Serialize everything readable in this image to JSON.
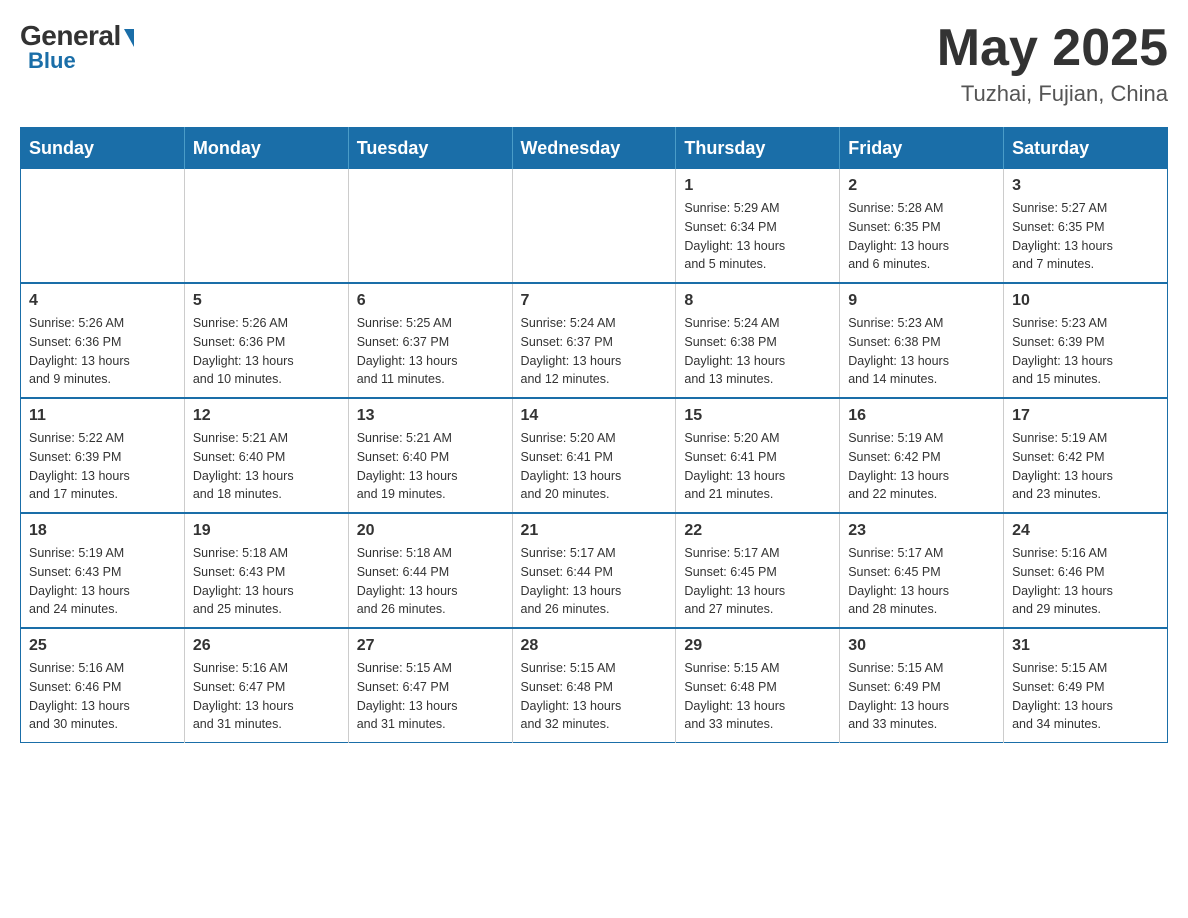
{
  "header": {
    "logo_general": "General",
    "logo_blue": "Blue",
    "month_year": "May 2025",
    "location": "Tuzhai, Fujian, China"
  },
  "days_of_week": [
    "Sunday",
    "Monday",
    "Tuesday",
    "Wednesday",
    "Thursday",
    "Friday",
    "Saturday"
  ],
  "weeks": [
    [
      {
        "day": "",
        "info": ""
      },
      {
        "day": "",
        "info": ""
      },
      {
        "day": "",
        "info": ""
      },
      {
        "day": "",
        "info": ""
      },
      {
        "day": "1",
        "info": "Sunrise: 5:29 AM\nSunset: 6:34 PM\nDaylight: 13 hours\nand 5 minutes."
      },
      {
        "day": "2",
        "info": "Sunrise: 5:28 AM\nSunset: 6:35 PM\nDaylight: 13 hours\nand 6 minutes."
      },
      {
        "day": "3",
        "info": "Sunrise: 5:27 AM\nSunset: 6:35 PM\nDaylight: 13 hours\nand 7 minutes."
      }
    ],
    [
      {
        "day": "4",
        "info": "Sunrise: 5:26 AM\nSunset: 6:36 PM\nDaylight: 13 hours\nand 9 minutes."
      },
      {
        "day": "5",
        "info": "Sunrise: 5:26 AM\nSunset: 6:36 PM\nDaylight: 13 hours\nand 10 minutes."
      },
      {
        "day": "6",
        "info": "Sunrise: 5:25 AM\nSunset: 6:37 PM\nDaylight: 13 hours\nand 11 minutes."
      },
      {
        "day": "7",
        "info": "Sunrise: 5:24 AM\nSunset: 6:37 PM\nDaylight: 13 hours\nand 12 minutes."
      },
      {
        "day": "8",
        "info": "Sunrise: 5:24 AM\nSunset: 6:38 PM\nDaylight: 13 hours\nand 13 minutes."
      },
      {
        "day": "9",
        "info": "Sunrise: 5:23 AM\nSunset: 6:38 PM\nDaylight: 13 hours\nand 14 minutes."
      },
      {
        "day": "10",
        "info": "Sunrise: 5:23 AM\nSunset: 6:39 PM\nDaylight: 13 hours\nand 15 minutes."
      }
    ],
    [
      {
        "day": "11",
        "info": "Sunrise: 5:22 AM\nSunset: 6:39 PM\nDaylight: 13 hours\nand 17 minutes."
      },
      {
        "day": "12",
        "info": "Sunrise: 5:21 AM\nSunset: 6:40 PM\nDaylight: 13 hours\nand 18 minutes."
      },
      {
        "day": "13",
        "info": "Sunrise: 5:21 AM\nSunset: 6:40 PM\nDaylight: 13 hours\nand 19 minutes."
      },
      {
        "day": "14",
        "info": "Sunrise: 5:20 AM\nSunset: 6:41 PM\nDaylight: 13 hours\nand 20 minutes."
      },
      {
        "day": "15",
        "info": "Sunrise: 5:20 AM\nSunset: 6:41 PM\nDaylight: 13 hours\nand 21 minutes."
      },
      {
        "day": "16",
        "info": "Sunrise: 5:19 AM\nSunset: 6:42 PM\nDaylight: 13 hours\nand 22 minutes."
      },
      {
        "day": "17",
        "info": "Sunrise: 5:19 AM\nSunset: 6:42 PM\nDaylight: 13 hours\nand 23 minutes."
      }
    ],
    [
      {
        "day": "18",
        "info": "Sunrise: 5:19 AM\nSunset: 6:43 PM\nDaylight: 13 hours\nand 24 minutes."
      },
      {
        "day": "19",
        "info": "Sunrise: 5:18 AM\nSunset: 6:43 PM\nDaylight: 13 hours\nand 25 minutes."
      },
      {
        "day": "20",
        "info": "Sunrise: 5:18 AM\nSunset: 6:44 PM\nDaylight: 13 hours\nand 26 minutes."
      },
      {
        "day": "21",
        "info": "Sunrise: 5:17 AM\nSunset: 6:44 PM\nDaylight: 13 hours\nand 26 minutes."
      },
      {
        "day": "22",
        "info": "Sunrise: 5:17 AM\nSunset: 6:45 PM\nDaylight: 13 hours\nand 27 minutes."
      },
      {
        "day": "23",
        "info": "Sunrise: 5:17 AM\nSunset: 6:45 PM\nDaylight: 13 hours\nand 28 minutes."
      },
      {
        "day": "24",
        "info": "Sunrise: 5:16 AM\nSunset: 6:46 PM\nDaylight: 13 hours\nand 29 minutes."
      }
    ],
    [
      {
        "day": "25",
        "info": "Sunrise: 5:16 AM\nSunset: 6:46 PM\nDaylight: 13 hours\nand 30 minutes."
      },
      {
        "day": "26",
        "info": "Sunrise: 5:16 AM\nSunset: 6:47 PM\nDaylight: 13 hours\nand 31 minutes."
      },
      {
        "day": "27",
        "info": "Sunrise: 5:15 AM\nSunset: 6:47 PM\nDaylight: 13 hours\nand 31 minutes."
      },
      {
        "day": "28",
        "info": "Sunrise: 5:15 AM\nSunset: 6:48 PM\nDaylight: 13 hours\nand 32 minutes."
      },
      {
        "day": "29",
        "info": "Sunrise: 5:15 AM\nSunset: 6:48 PM\nDaylight: 13 hours\nand 33 minutes."
      },
      {
        "day": "30",
        "info": "Sunrise: 5:15 AM\nSunset: 6:49 PM\nDaylight: 13 hours\nand 33 minutes."
      },
      {
        "day": "31",
        "info": "Sunrise: 5:15 AM\nSunset: 6:49 PM\nDaylight: 13 hours\nand 34 minutes."
      }
    ]
  ]
}
